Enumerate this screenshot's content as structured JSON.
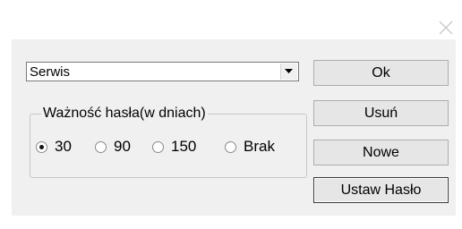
{
  "dialog": {
    "close_icon": "close-icon"
  },
  "user_select": {
    "value": "Serwis"
  },
  "validity": {
    "legend": "Ważność hasła(w dniach)",
    "options": [
      {
        "label": "30",
        "checked": true
      },
      {
        "label": "90",
        "checked": false
      },
      {
        "label": "150",
        "checked": false
      },
      {
        "label": "Brak",
        "checked": false
      }
    ]
  },
  "buttons": {
    "ok": "Ok",
    "remove": "Usuń",
    "new": "Nowe",
    "set_password": "Ustaw Hasło"
  }
}
